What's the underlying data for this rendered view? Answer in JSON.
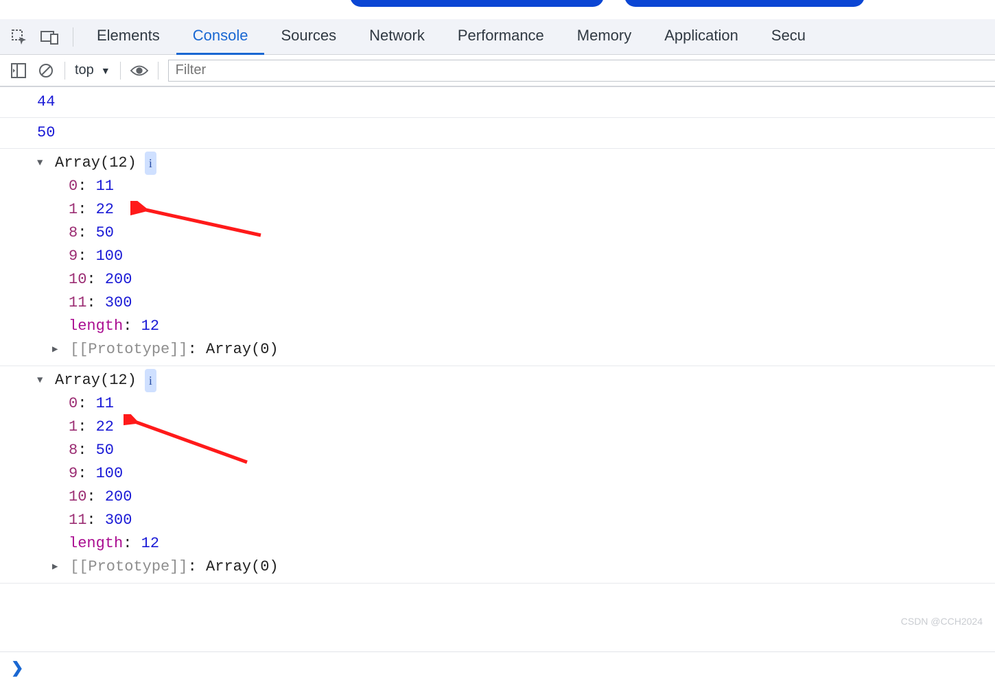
{
  "tabs": {
    "elements": "Elements",
    "console": "Console",
    "sources": "Sources",
    "network": "Network",
    "performance": "Performance",
    "memory": "Memory",
    "application": "Application",
    "security": "Secu"
  },
  "toolbar": {
    "context": "top",
    "filter_placeholder": "Filter"
  },
  "logs": {
    "line1": "44",
    "line2": "50"
  },
  "arrays": [
    {
      "header": "Array(12)",
      "entries": [
        {
          "key": "0",
          "value": "11"
        },
        {
          "key": "1",
          "value": "22"
        },
        {
          "key": "8",
          "value": "50"
        },
        {
          "key": "9",
          "value": "100"
        },
        {
          "key": "10",
          "value": "200"
        },
        {
          "key": "11",
          "value": "300"
        }
      ],
      "length_label": "length",
      "length_value": "12",
      "proto_label": "[[Prototype]]",
      "proto_value": "Array(0)"
    },
    {
      "header": "Array(12)",
      "entries": [
        {
          "key": "0",
          "value": "11"
        },
        {
          "key": "1",
          "value": "22"
        },
        {
          "key": "8",
          "value": "50"
        },
        {
          "key": "9",
          "value": "100"
        },
        {
          "key": "10",
          "value": "200"
        },
        {
          "key": "11",
          "value": "300"
        }
      ],
      "length_label": "length",
      "length_value": "12",
      "proto_label": "[[Prototype]]",
      "proto_value": "Array(0)"
    }
  ],
  "info_badge": "i",
  "watermark": "CSDN @CCH2024"
}
